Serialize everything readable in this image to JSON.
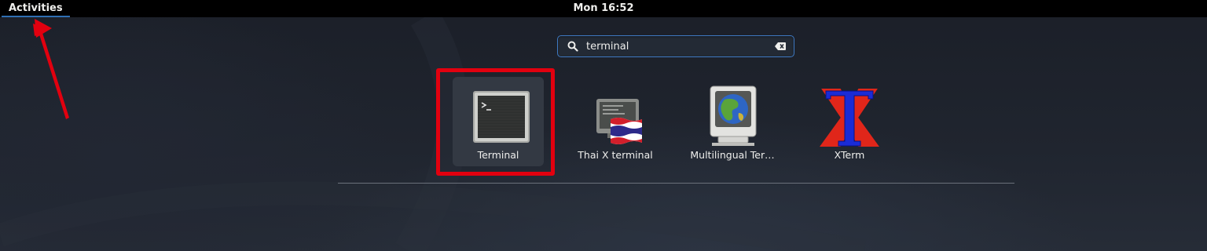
{
  "topbar": {
    "activities_label": "Activities",
    "clock": "Mon 16:52"
  },
  "search": {
    "value": "terminal",
    "icon": "search-icon",
    "clear_icon": "backspace-clear-icon"
  },
  "results": [
    {
      "label": "Terminal",
      "icon": "terminal-icon",
      "selected": true
    },
    {
      "label": "Thai X terminal",
      "icon": "thai-xterm-icon",
      "selected": false
    },
    {
      "label": "Multilingual Ter…",
      "icon": "multilingual-terminal-icon",
      "selected": false
    },
    {
      "label": "XTerm",
      "icon": "xterm-icon",
      "selected": false
    }
  ],
  "annotations": {
    "highlight_color": "#e2000f",
    "arrow_color": "#e2000f"
  }
}
